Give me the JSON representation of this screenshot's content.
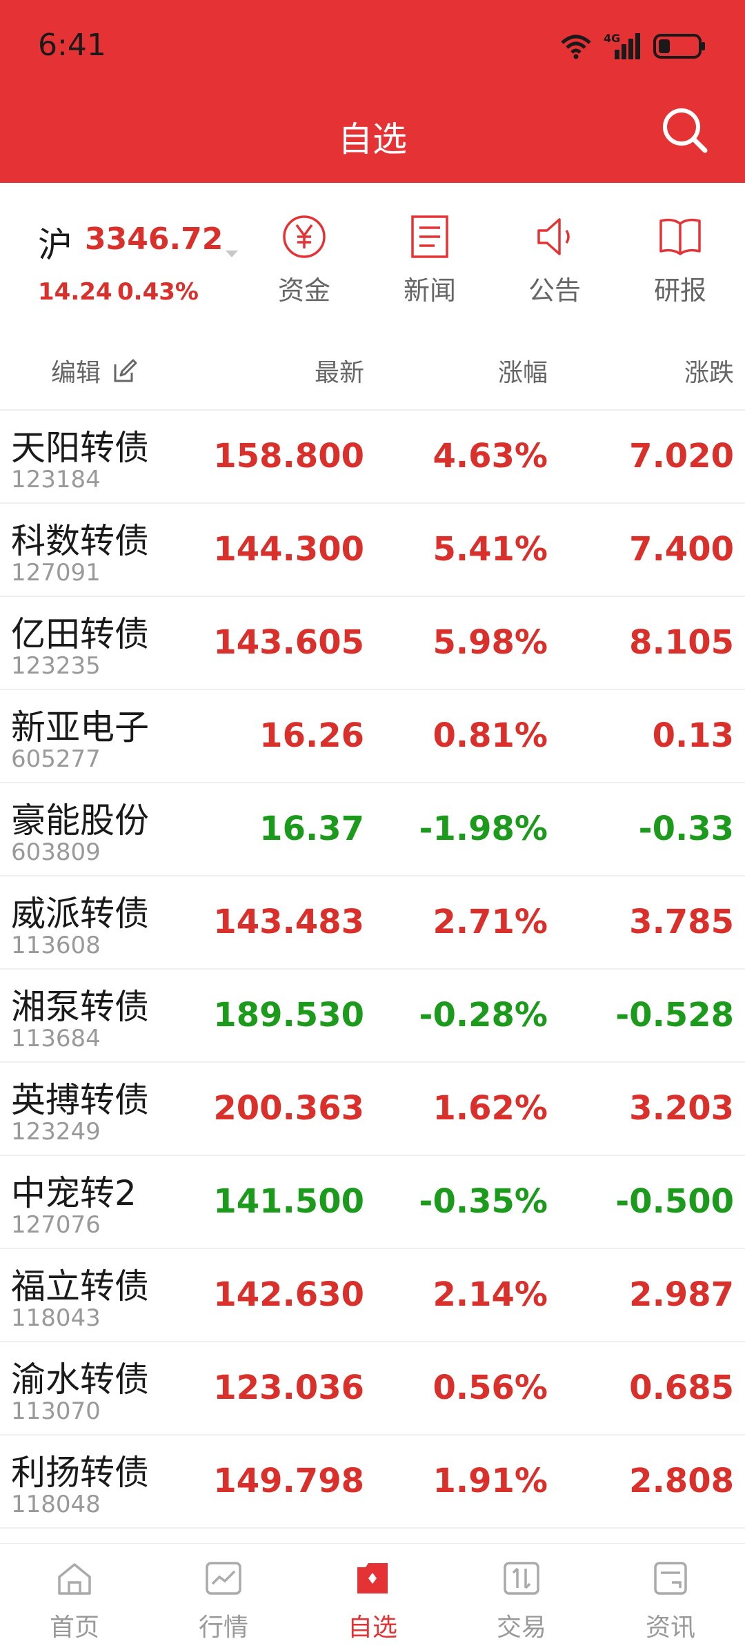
{
  "status_bar": {
    "time": "6:41",
    "network": "4G"
  },
  "header": {
    "title": "自选"
  },
  "index": {
    "name": "沪",
    "value": "3346.72",
    "change": "14.24",
    "change_pct": "0.43%"
  },
  "quick_actions": [
    {
      "label": "资金",
      "icon": "yuan-circle-icon"
    },
    {
      "label": "新闻",
      "icon": "document-icon"
    },
    {
      "label": "公告",
      "icon": "speaker-icon"
    },
    {
      "label": "研报",
      "icon": "book-icon"
    }
  ],
  "columns": {
    "edit": "编辑",
    "latest": "最新",
    "change_pct": "涨幅",
    "change": "涨跌"
  },
  "colors": {
    "brand": "#e53234",
    "up": "#d9302b",
    "down": "#1c9a1c"
  },
  "stocks": [
    {
      "name": "天阳转债",
      "code": "123184",
      "price": "158.800",
      "pct": "4.63%",
      "change": "7.020",
      "dir": "up"
    },
    {
      "name": "科数转债",
      "code": "127091",
      "price": "144.300",
      "pct": "5.41%",
      "change": "7.400",
      "dir": "up"
    },
    {
      "name": "亿田转债",
      "code": "123235",
      "price": "143.605",
      "pct": "5.98%",
      "change": "8.105",
      "dir": "up"
    },
    {
      "name": "新亚电子",
      "code": "605277",
      "price": "16.26",
      "pct": "0.81%",
      "change": "0.13",
      "dir": "up"
    },
    {
      "name": "豪能股份",
      "code": "603809",
      "price": "16.37",
      "pct": "-1.98%",
      "change": "-0.33",
      "dir": "down"
    },
    {
      "name": "威派转债",
      "code": "113608",
      "price": "143.483",
      "pct": "2.71%",
      "change": "3.785",
      "dir": "up"
    },
    {
      "name": "湘泵转债",
      "code": "113684",
      "price": "189.530",
      "pct": "-0.28%",
      "change": "-0.528",
      "dir": "down"
    },
    {
      "name": "英搏转债",
      "code": "123249",
      "price": "200.363",
      "pct": "1.62%",
      "change": "3.203",
      "dir": "up"
    },
    {
      "name": "中宠转2",
      "code": "127076",
      "price": "141.500",
      "pct": "-0.35%",
      "change": "-0.500",
      "dir": "down"
    },
    {
      "name": "福立转债",
      "code": "118043",
      "price": "142.630",
      "pct": "2.14%",
      "change": "2.987",
      "dir": "up"
    },
    {
      "name": "渝水转债",
      "code": "113070",
      "price": "123.036",
      "pct": "0.56%",
      "change": "0.685",
      "dir": "up"
    },
    {
      "name": "利扬转债",
      "code": "118048",
      "price": "149.798",
      "pct": "1.91%",
      "change": "2.808",
      "dir": "up"
    }
  ],
  "tabs": [
    {
      "label": "首页",
      "icon": "home-icon"
    },
    {
      "label": "行情",
      "icon": "chart-icon"
    },
    {
      "label": "自选",
      "icon": "watchlist-icon",
      "active": true
    },
    {
      "label": "交易",
      "icon": "trade-icon"
    },
    {
      "label": "资讯",
      "icon": "news-icon"
    }
  ]
}
